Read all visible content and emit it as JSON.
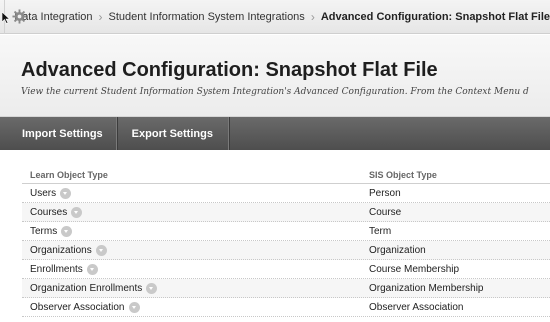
{
  "breadcrumb": {
    "items": [
      {
        "label": "Data Integration"
      },
      {
        "label": "Student Information System Integrations"
      },
      {
        "label": "Advanced Configuration: Snapshot Flat File"
      }
    ],
    "separator": "›"
  },
  "page": {
    "title": "Advanced Configuration: Snapshot Flat File",
    "description": "View the current Student Information System Integration's Advanced Configuration. From the Context Menu d"
  },
  "actions": {
    "import_label": "Import Settings",
    "export_label": "Export Settings"
  },
  "table": {
    "headers": {
      "learn": "Learn Object Type",
      "sis": "SIS Object Type"
    },
    "rows": [
      {
        "learn": "Users",
        "sis": "Person"
      },
      {
        "learn": "Courses",
        "sis": "Course"
      },
      {
        "learn": "Terms",
        "sis": "Term"
      },
      {
        "learn": "Organizations",
        "sis": "Organization"
      },
      {
        "learn": "Enrollments",
        "sis": "Course Membership"
      },
      {
        "learn": "Organization Enrollments",
        "sis": "Organization Membership"
      },
      {
        "learn": "Observer Association",
        "sis": "Observer Association"
      }
    ]
  },
  "icons": {
    "cursor": "cursor-icon",
    "gear": "gear-icon",
    "context_menu": "chevron-down-icon"
  },
  "colors": {
    "action_bar": "#5a5a5a",
    "context_button": "#c9c9c9"
  }
}
